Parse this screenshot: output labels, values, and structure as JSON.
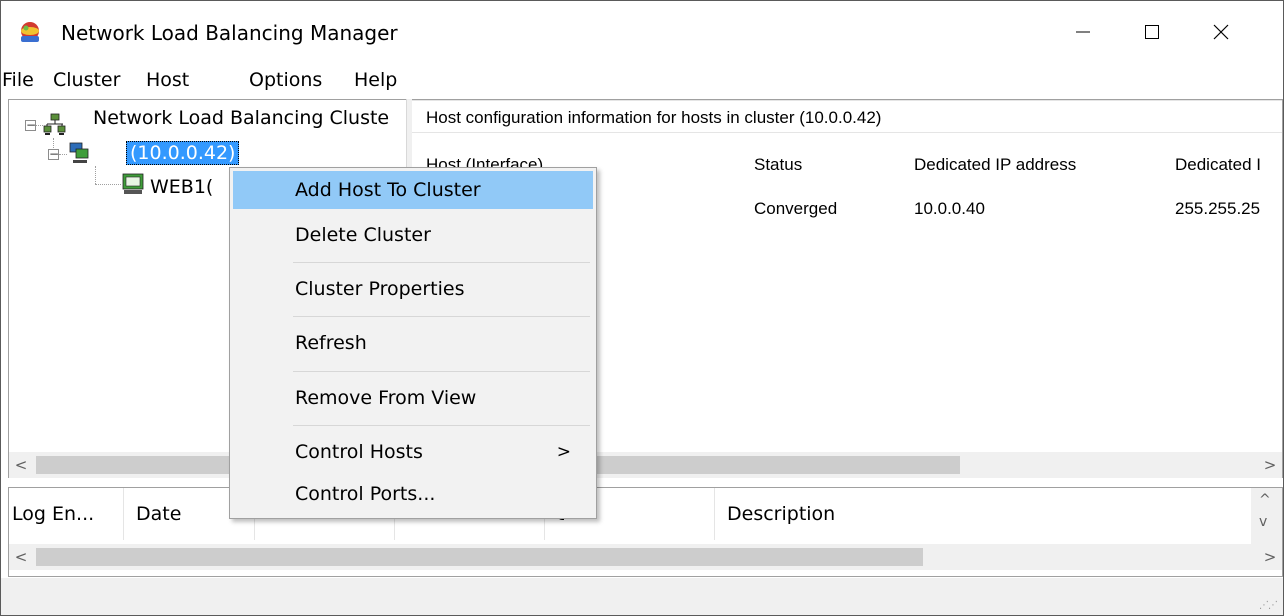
{
  "window": {
    "title": "Network Load Balancing Manager",
    "minimize_glyph": "—",
    "maximize_glyph": "☐",
    "close_glyph": "✕",
    "icon": "nlb-app-icon"
  },
  "menubar": {
    "items": [
      "File",
      "Cluster",
      "Host",
      "Options",
      "Help"
    ]
  },
  "tree": {
    "root_label": "Network Load Balancing Cluste",
    "cluster_label": "(10.0.0.42)",
    "host_label": "WEB1("
  },
  "host_panel": {
    "header": "Host configuration information for hosts in cluster  (10.0.0.42)",
    "columns": [
      "Host (Interface)",
      "Status",
      "Dedicated IP address",
      "Dedicated I"
    ],
    "rows": [
      {
        "host": ")",
        "status": "Converged",
        "dedicated_ip": "10.0.0.40",
        "dedicated_mask": "255.255.25"
      }
    ]
  },
  "log_panel": {
    "columns": [
      "Log En...",
      "Date",
      "",
      "",
      "t",
      "Description"
    ]
  },
  "scroll": {
    "left": "<",
    "right": ">",
    "up": "^",
    "down": "v"
  },
  "context_menu": {
    "items": [
      {
        "label": "Add Host To Cluster",
        "highlighted": true
      },
      {
        "label": "Delete Cluster"
      },
      {
        "label": "Cluster Properties"
      },
      {
        "label": "Refresh"
      },
      {
        "label": "Remove From View"
      },
      {
        "label": "Control Hosts",
        "submenu_arrow": ">"
      },
      {
        "label": "Control Ports..."
      }
    ]
  },
  "colors": {
    "selection": "#3399ff",
    "menu_highlight": "#91c9f7",
    "scroll_track": "#f0f0f0"
  }
}
